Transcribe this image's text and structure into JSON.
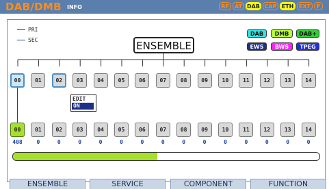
{
  "header": {
    "title": "DAB/DMB",
    "subtitle": "INFO",
    "indicators": [
      {
        "label": "RF",
        "text_color": "#ff8c1a",
        "bg": "#5b7fad",
        "border": "#ff8c1a",
        "active": false
      },
      {
        "label": "AT",
        "text_color": "#ff8c1a",
        "bg": "#5b7fad",
        "border": "#ff8c1a",
        "active": false
      },
      {
        "label": "DAB",
        "text_color": "#222222",
        "bg": "#ffff00",
        "border": "#ffff00",
        "active": true
      },
      {
        "label": "CAP",
        "text_color": "#ff8c1a",
        "bg": "#5b7fad",
        "border": "#ff8c1a",
        "active": false
      },
      {
        "label": "ETH",
        "text_color": "#222222",
        "bg": "#ffff00",
        "border": "#ffff00",
        "active": true
      },
      {
        "label": "EXT",
        "text_color": "#ff8c1a",
        "bg": "#5b7fad",
        "border": "#ff8c1a",
        "active": false
      },
      {
        "label": "F",
        "text_color": "#ff8c1a",
        "bg": "#5b7fad",
        "border": "#ff8c1a",
        "active": false
      }
    ]
  },
  "legend": {
    "pri": {
      "label": "PRI",
      "color": "#cc0000"
    },
    "sec": {
      "label": "SEC",
      "color": "#1a3fa3"
    }
  },
  "badges": [
    {
      "label": "DAB",
      "bg": "#37e0e0",
      "fg": "#111111"
    },
    {
      "label": "DMB",
      "bg": "#b6ff3a",
      "fg": "#111111"
    },
    {
      "label": "DAB+",
      "bg": "#33cc33",
      "fg": "#111111"
    },
    {
      "label": "EWS",
      "bg": "#1c2f8a",
      "fg": "#ffffff"
    },
    {
      "label": "BWS",
      "bg": "#ff22ff",
      "fg": "#ffffff"
    },
    {
      "label": "TPEG",
      "bg": "#1f2fd9",
      "fg": "#ffffff"
    }
  ],
  "ensemble": {
    "label": "ENSEMBLE"
  },
  "services": [
    "00",
    "01",
    "02",
    "03",
    "04",
    "05",
    "06",
    "07",
    "08",
    "09",
    "10",
    "11",
    "12",
    "13",
    "14"
  ],
  "service_selected": "00",
  "service_focused": "02",
  "edit": {
    "label": "EDIT",
    "value": "ON"
  },
  "components": [
    "00",
    "01",
    "02",
    "03",
    "04",
    "05",
    "06",
    "07",
    "08",
    "09",
    "10",
    "11",
    "12",
    "13",
    "14"
  ],
  "component_active": "00",
  "counts": [
    "408",
    "0",
    "0",
    "0",
    "0",
    "0",
    "0",
    "0",
    "0",
    "0",
    "0",
    "0",
    "0",
    "0",
    "0"
  ],
  "progress": {
    "value": 0.47,
    "color": "#a6e02a"
  },
  "tabs": [
    "ENSEMBLE",
    "SERVICE",
    "COMPONENT",
    "FUNCTION"
  ]
}
